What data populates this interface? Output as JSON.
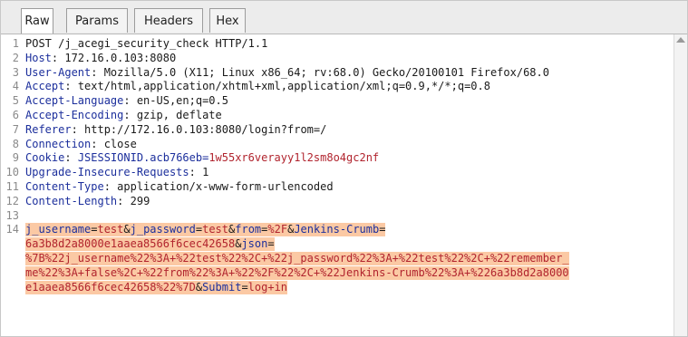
{
  "tabs": [
    {
      "label": "Raw"
    },
    {
      "label": "Params"
    },
    {
      "label": "Headers"
    },
    {
      "label": "Hex"
    }
  ],
  "request": {
    "line_numbers": [
      "1",
      "2",
      "3",
      "4",
      "5",
      "6",
      "7",
      "8",
      "9",
      "10",
      "11",
      "12",
      "13",
      "14"
    ],
    "request_line": "POST /j_acegi_security_check HTTP/1.1",
    "headers": [
      {
        "name": "Host",
        "value": " 172.16.0.103:8080"
      },
      {
        "name": "User-Agent",
        "value": " Mozilla/5.0 (X11; Linux x86_64; rv:68.0) Gecko/20100101 Firefox/68.0"
      },
      {
        "name": "Accept",
        "value": " text/html,application/xhtml+xml,application/xml;q=0.9,*/*;q=0.8"
      },
      {
        "name": "Accept-Language",
        "value": " en-US,en;q=0.5"
      },
      {
        "name": "Accept-Encoding",
        "value": " gzip, deflate"
      },
      {
        "name": "Referer",
        "value": " http://172.16.0.103:8080/login?from=/"
      },
      {
        "name": "Connection",
        "value": " close"
      },
      {
        "name": "Cookie",
        "cookie_name": " JSESSIONID.acb766eb",
        "cookie_value": "1w55xr6verayy1l2sm8o4gc2nf"
      },
      {
        "name": "Upgrade-Insecure-Requests",
        "value": " 1"
      },
      {
        "name": "Content-Type",
        "value": " application/x-www-form-urlencoded"
      },
      {
        "name": "Content-Length",
        "value": " 299"
      }
    ],
    "body_lines": [
      [
        {
          "t": "k",
          "s": "j_username"
        },
        {
          "t": "s",
          "s": "="
        },
        {
          "t": "v",
          "s": "test"
        },
        {
          "t": "s",
          "s": "&"
        },
        {
          "t": "k",
          "s": "j_password"
        },
        {
          "t": "s",
          "s": "="
        },
        {
          "t": "v",
          "s": "test"
        },
        {
          "t": "s",
          "s": "&"
        },
        {
          "t": "k",
          "s": "from"
        },
        {
          "t": "s",
          "s": "="
        },
        {
          "t": "v",
          "s": "%2F"
        },
        {
          "t": "s",
          "s": "&"
        },
        {
          "t": "k",
          "s": "Jenkins-Crumb"
        },
        {
          "t": "s",
          "s": "="
        }
      ],
      [
        {
          "t": "v",
          "s": "6a3b8d2a8000e1aaea8566f6cec42658"
        },
        {
          "t": "s",
          "s": "&"
        },
        {
          "t": "k",
          "s": "json"
        },
        {
          "t": "s",
          "s": "="
        }
      ],
      [
        {
          "t": "v",
          "s": "%7B%22j_username%22%3A+%22test%22%2C+%22j_password%22%3A+%22test%22%2C+%22remember_"
        }
      ],
      [
        {
          "t": "v",
          "s": "me%22%3A+false%2C+%22from%22%3A+%22%2F%22%2C+%22Jenkins-Crumb%22%3A+%226a3b8d2a8000"
        }
      ],
      [
        {
          "t": "v",
          "s": "e1aaea8566f6cec42658%22%7D"
        },
        {
          "t": "s",
          "s": "&"
        },
        {
          "t": "k",
          "s": "Submit"
        },
        {
          "t": "s",
          "s": "="
        },
        {
          "t": "v",
          "s": "log+in"
        }
      ]
    ]
  }
}
